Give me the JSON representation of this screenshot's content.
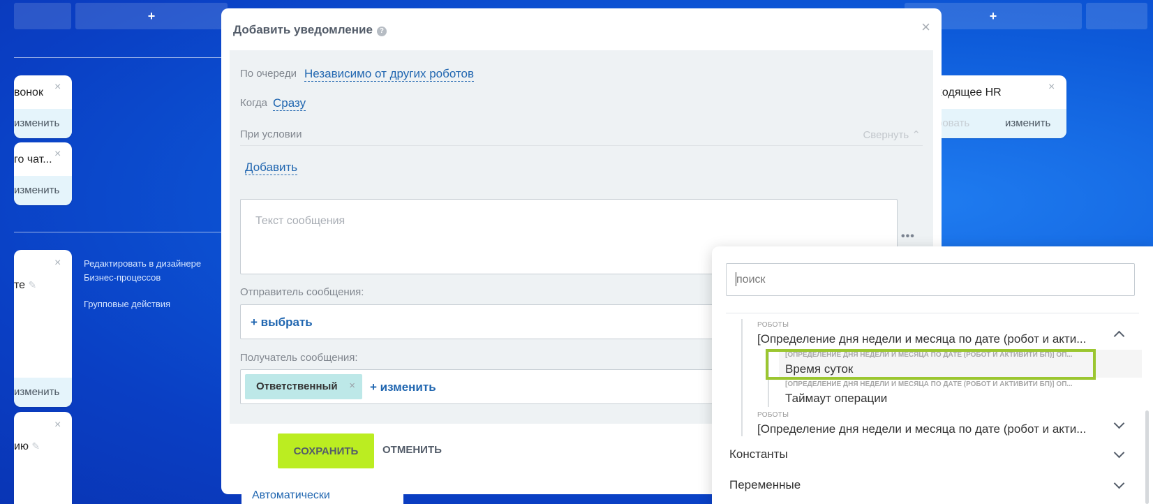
{
  "board": {
    "col_plus_1": "+",
    "col_plus_2": "+",
    "cards": [
      {
        "title": "вонок",
        "action": "изменить"
      },
      {
        "title": "го чат...",
        "action": "изменить"
      },
      {
        "title": "те",
        "action": "изменить"
      },
      {
        "title": "ию",
        "action": ""
      },
      {
        "title": "ходящее HR",
        "action_disabled": "ровать",
        "action": "изменить"
      }
    ],
    "bp_designer_link": "Редактировать в дизайнере Бизнес-процессов",
    "group_actions_link": "Групповые действия"
  },
  "modal": {
    "title": "Добавить уведомление",
    "help": "?",
    "close": "×",
    "queue_label": "По очереди",
    "queue_value": "Независимо от других роботов",
    "when_label": "Когда",
    "when_value": "Сразу",
    "condition_label": "При условии",
    "collapse_label": "Свернуть",
    "add_label": "Добавить",
    "message_placeholder": "Текст сообщения",
    "dots": "•••",
    "sender_label": "Отправитель сообщения:",
    "sender_select": "+ выбрать",
    "recipient_label": "Получатель сообщения:",
    "recipient_tag": "Ответственный",
    "recipient_tag_remove": "×",
    "recipient_change": "+ изменить",
    "save_button": "СОХРАНИТЬ",
    "cancel_button": "ОТМЕНИТЬ",
    "auto_value": "Автоматически"
  },
  "popup": {
    "search_placeholder": "поиск",
    "group1_small": "РОБОТЫ",
    "group1_title": "[Определение дня недели и месяца по дате (робот и акти...",
    "item1_small": "[ОПРЕДЕЛЕНИЕ ДНЯ НЕДЕЛИ И МЕСЯЦА ПО ДАТЕ (РОБОТ И АКТИВИТИ БП)] ОП...",
    "item1_title": "Время суток",
    "item2_small": "[ОПРЕДЕЛЕНИЕ ДНЯ НЕДЕЛИ И МЕСЯЦА ПО ДАТЕ (РОБОТ И АКТИВИТИ БП)] ОП...",
    "item2_title": "Таймаут операции",
    "group2_small": "РОБОТЫ",
    "group2_title": "[Определение дня недели и месяца по дате (робот и акти...",
    "section_constants": "Константы",
    "section_variables": "Переменные"
  }
}
